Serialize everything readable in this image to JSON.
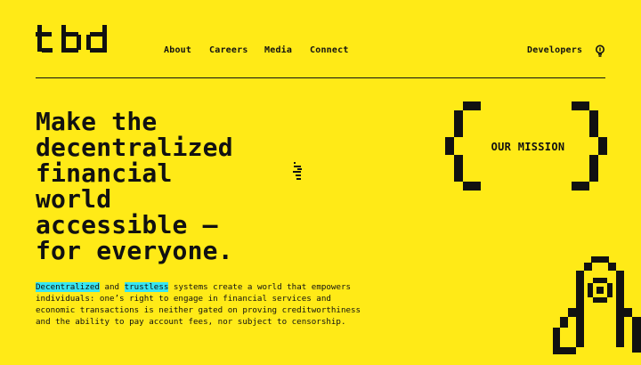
{
  "brand": {
    "logo_text": "tbd"
  },
  "nav": {
    "items": [
      "About",
      "Careers",
      "Media",
      "Connect"
    ],
    "developers_label": "Developers",
    "icon": "lightbulb-icon"
  },
  "hero": {
    "headline_lines": [
      "Make the",
      "decentralized",
      "financial",
      "world",
      "accessible –",
      "for everyone."
    ],
    "mission_label": "OUR MISSION",
    "description": {
      "highlight_1": "Decentralized",
      "connector": " and ",
      "highlight_2": "trustless",
      "rest": " systems create a world that empowers individuals: one’s right to engage in financial services and economic transactions is neither gated on proving creditworthiness and the ability to pay account fees, nor subject to censorship."
    }
  },
  "colors": {
    "background": "#FFEA17",
    "text": "#111111",
    "highlight": "#37E6F2"
  }
}
